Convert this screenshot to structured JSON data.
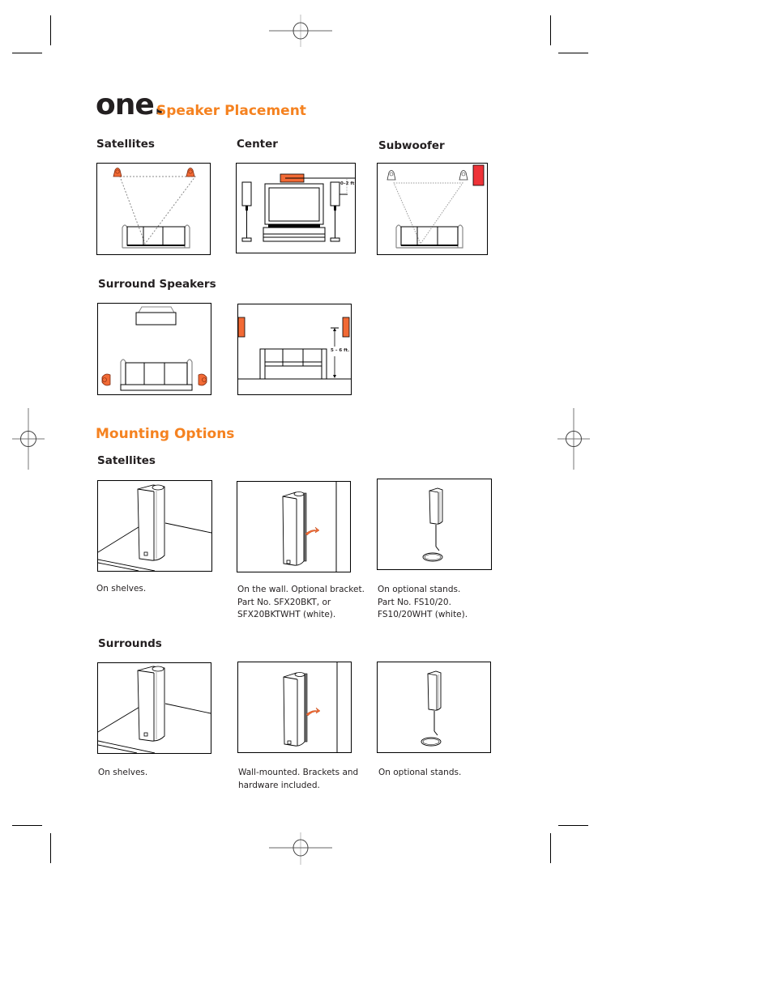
{
  "page": {
    "title_number": "one.",
    "title_text": "Speaker Placement"
  },
  "placement": {
    "satellites_label": "Satellites",
    "center_label": "Center",
    "subwoofer_label": "Subwoofer",
    "surround_label": "Surround Speakers",
    "center_distance_label": "0–2 ft.",
    "surround_height_label": "5 – 6 ft."
  },
  "mounting": {
    "heading": "Mounting Options",
    "satellites": {
      "label": "Satellites",
      "options": [
        {
          "icon": "shelf-speaker-icon",
          "caption": [
            "On shelves."
          ]
        },
        {
          "icon": "wall-bracket-speaker-icon",
          "caption": [
            "On the wall. Optional bracket.",
            "Part No. SFX20BKT, or",
            "SFX20BKTWHT (white)."
          ]
        },
        {
          "icon": "floor-stand-speaker-icon",
          "caption": [
            "On optional stands.",
            "Part No. FS10/20.",
            "FS10/20WHT (white)."
          ]
        }
      ]
    },
    "surrounds": {
      "label": "Surrounds",
      "options": [
        {
          "icon": "shelf-speaker-icon",
          "caption": [
            "On shelves."
          ]
        },
        {
          "icon": "wall-bracket-speaker-icon",
          "caption": [
            "Wall-mounted. Brackets and",
            "hardware included."
          ]
        },
        {
          "icon": "floor-stand-speaker-icon",
          "caption": [
            "On optional stands."
          ]
        }
      ]
    }
  },
  "colors": {
    "accent_orange": "#f58220",
    "speaker_orange": "#f26a35",
    "subwoofer_red": "#ee3338",
    "text": "#231f20"
  }
}
